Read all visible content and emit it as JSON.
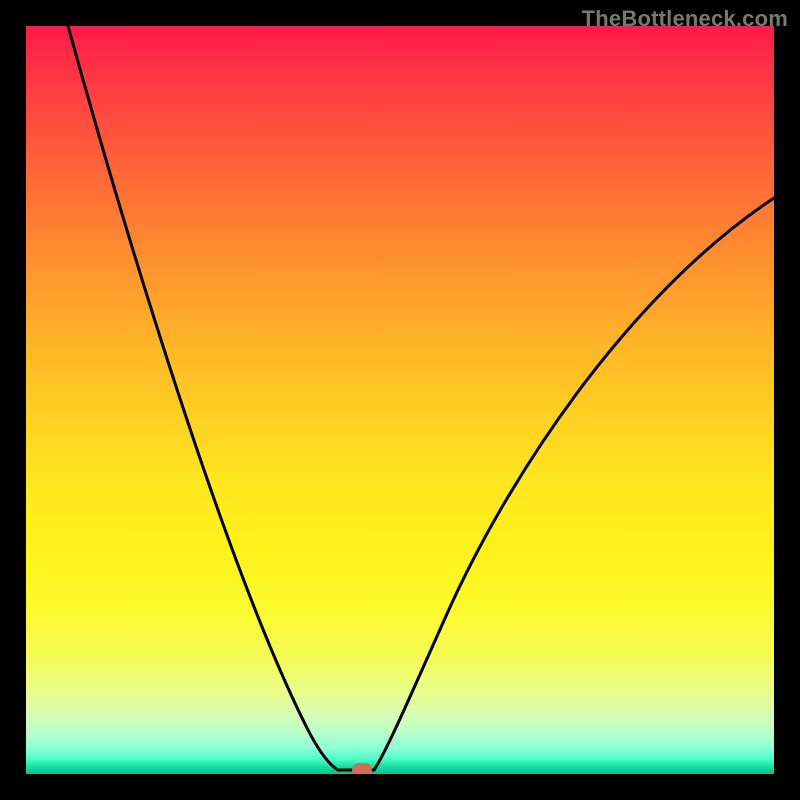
{
  "watermark": "TheBottleneck.com",
  "colors": {
    "frame_background": "#000000",
    "curve_stroke": "#000000",
    "marker_fill": "#d36a5a",
    "gradient_top": "#ff1a4b",
    "gradient_mid": "#ffe61e",
    "gradient_bottom": "#0fc08d"
  },
  "chart_data": {
    "type": "line",
    "title": "",
    "xlabel": "",
    "ylabel": "",
    "xlim": [
      0,
      100
    ],
    "ylim": [
      0,
      100
    ],
    "grid": false,
    "legend": false,
    "annotations": [
      {
        "name": "minimum-marker",
        "x": 45,
        "y": 0,
        "shape": "pill",
        "color": "#d36a5a"
      }
    ],
    "series": [
      {
        "name": "v-curve",
        "description": "Black V-shaped curve drawn over a vertical red→green gradient. Values estimated from pixel positions; no axes or tick labels present.",
        "x": [
          5,
          10,
          15,
          20,
          25,
          30,
          35,
          40,
          42,
          45,
          47,
          50,
          55,
          60,
          65,
          70,
          75,
          80,
          85,
          90,
          95,
          100
        ],
        "values": [
          100,
          86,
          72,
          58,
          44,
          30,
          18,
          6,
          1,
          0,
          0,
          3,
          12,
          23,
          34,
          44,
          53,
          61,
          68,
          73,
          76,
          78
        ]
      }
    ]
  }
}
